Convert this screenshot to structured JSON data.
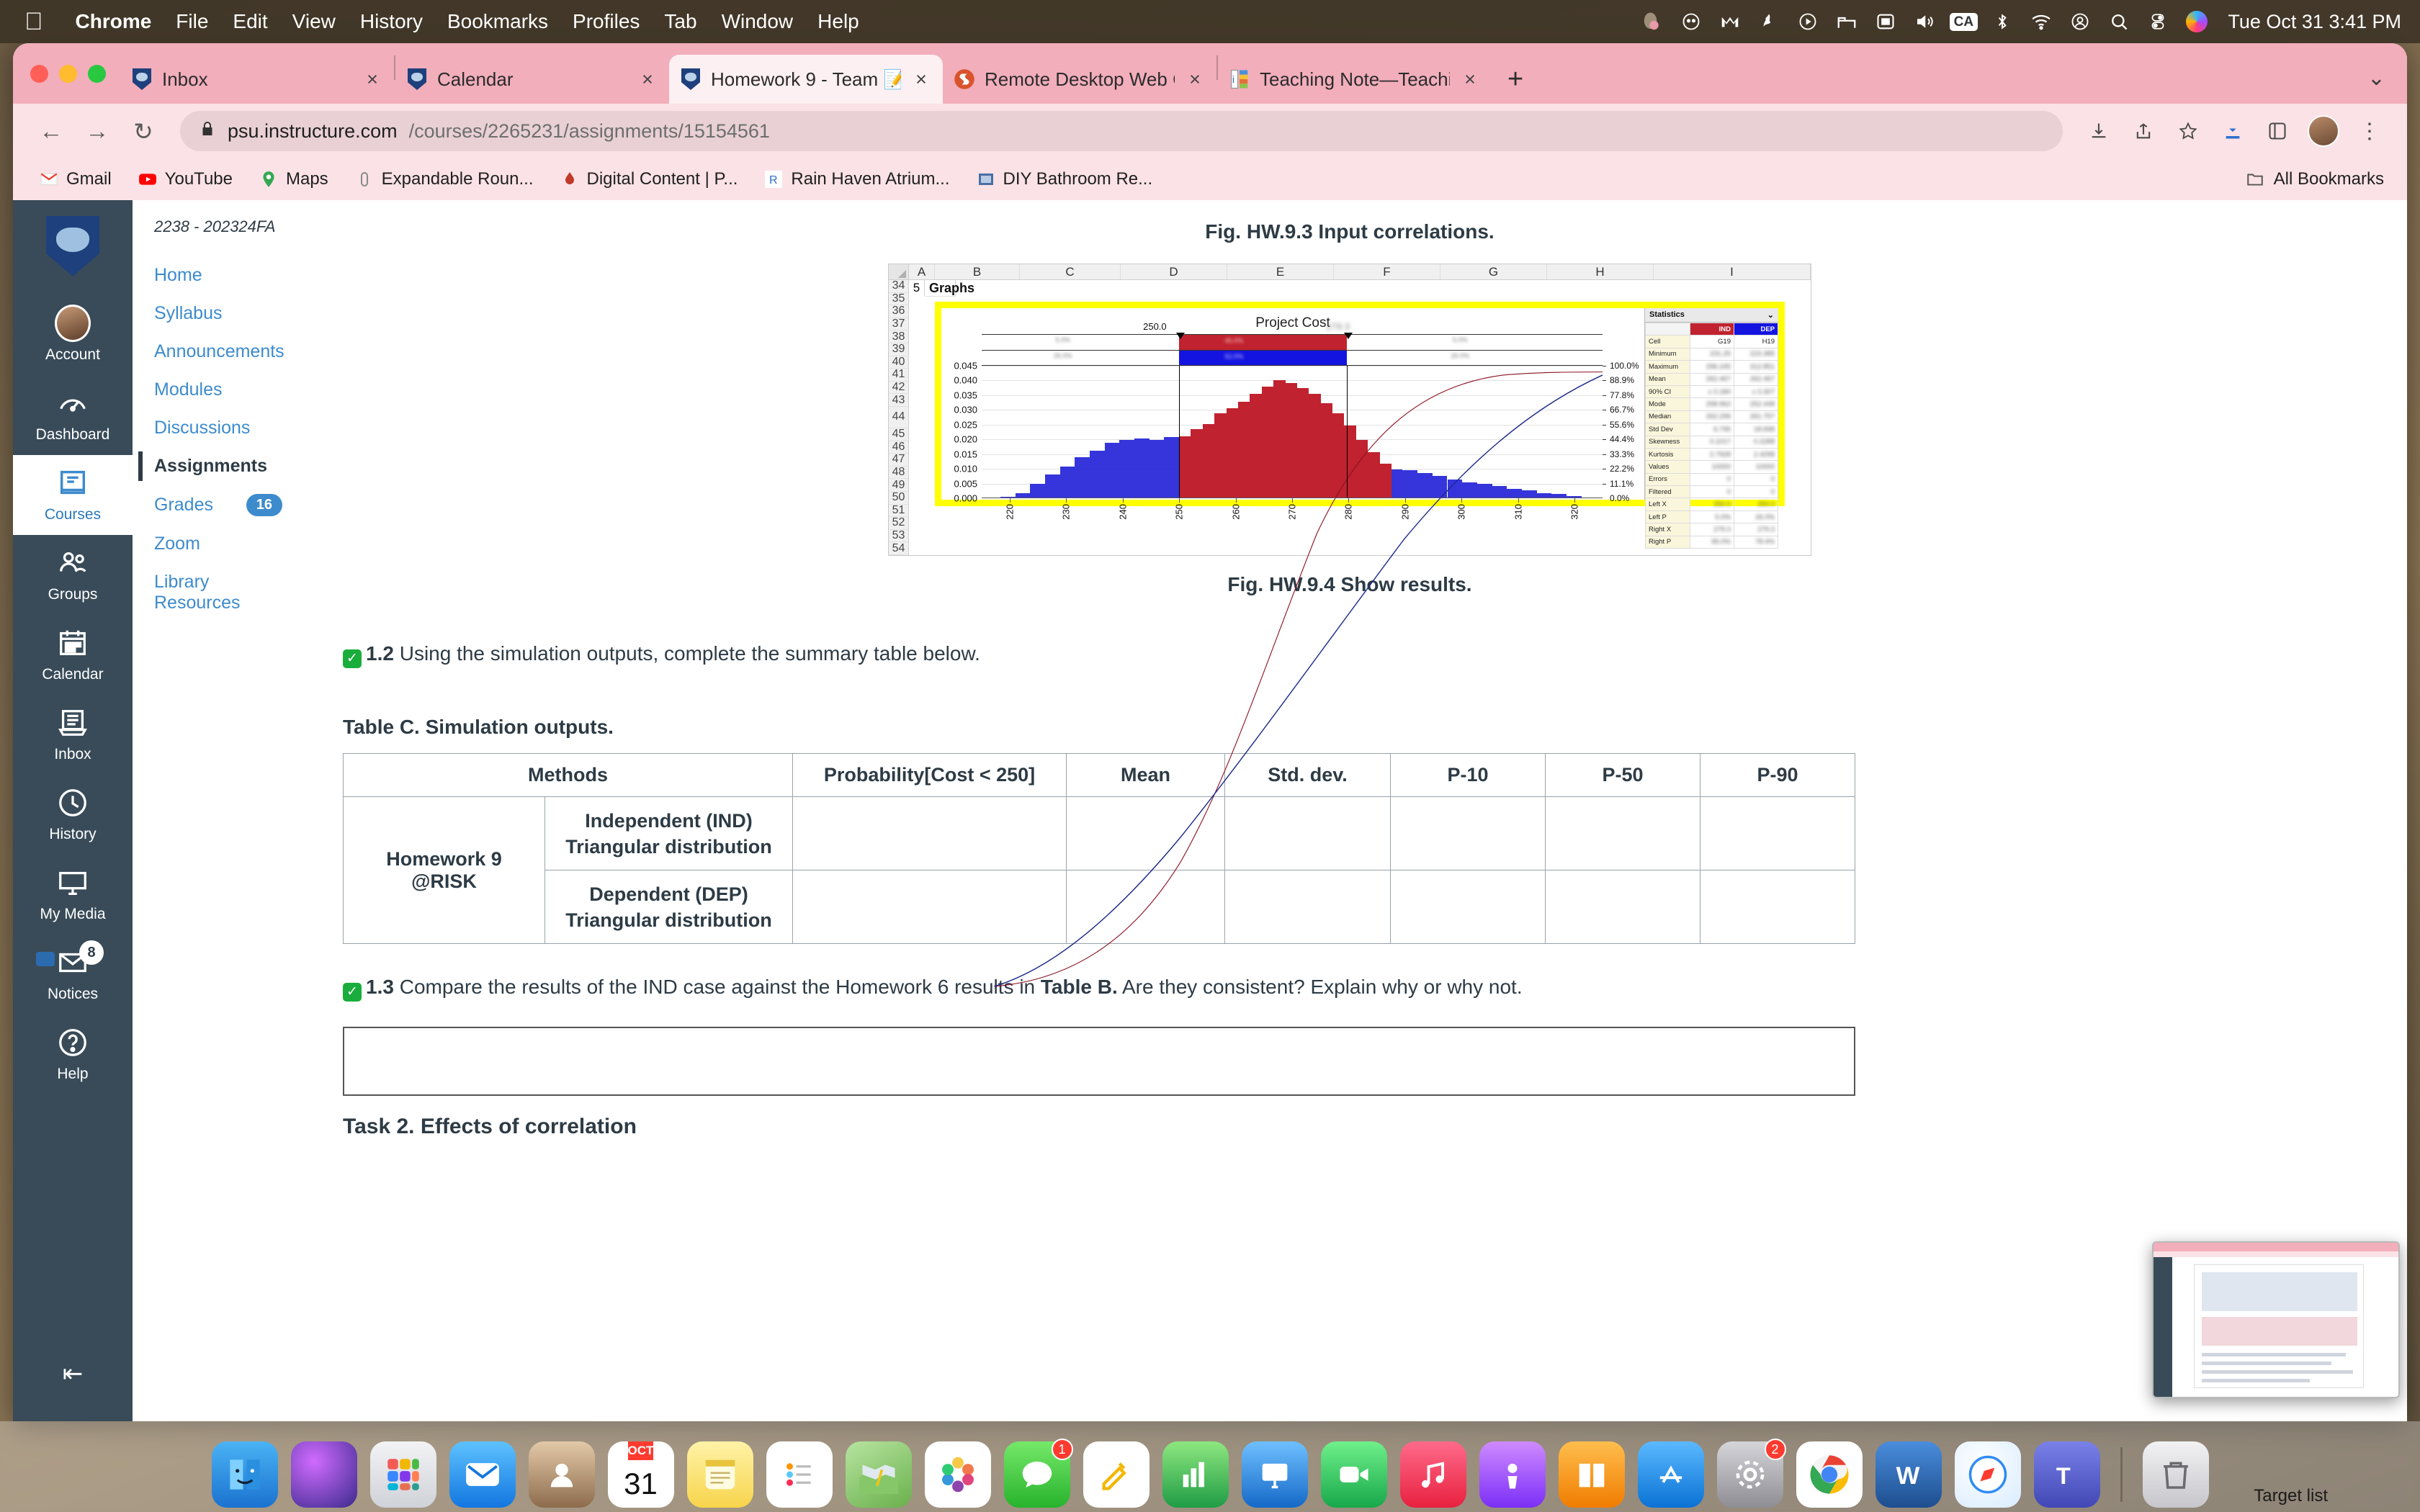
{
  "menubar": {
    "apple": "",
    "items": [
      {
        "label": "Chrome",
        "bold": true
      },
      {
        "label": "File",
        "bold": false
      },
      {
        "label": "Edit",
        "bold": false
      },
      {
        "label": "View",
        "bold": false
      },
      {
        "label": "History",
        "bold": false
      },
      {
        "label": "Bookmarks",
        "bold": false
      },
      {
        "label": "Profiles",
        "bold": false
      },
      {
        "label": "Tab",
        "bold": false
      },
      {
        "label": "Window",
        "bold": false
      },
      {
        "label": "Help",
        "bold": false
      }
    ],
    "status_icons": [
      "grammarly-icon",
      "ghost-icon",
      "mendeley-icon",
      "dropbox-icon",
      "play-circle-icon",
      "bed-icon",
      "screen-icon",
      "volume-icon",
      "ca-badge-icon",
      "bluetooth-icon",
      "wifi-icon",
      "user-circle-icon",
      "spotlight-search-icon",
      "control-center-icon",
      "siri-icon"
    ],
    "ca_badge": "CA",
    "clock": "Tue Oct 31  3:41 PM"
  },
  "browser": {
    "tabs": [
      {
        "title": "Inbox",
        "favicon": "psu-shield-icon",
        "active": false,
        "close": "×"
      },
      {
        "title": "Calendar",
        "favicon": "psu-shield-icon",
        "active": false,
        "close": "×"
      },
      {
        "title": "Homework 9 - Team 📝",
        "favicon": "psu-shield-icon",
        "active": true,
        "close": "×"
      },
      {
        "title": "Remote Desktop Web Client",
        "favicon": "remote-desktop-icon",
        "active": false,
        "close": "×"
      },
      {
        "title": "Teaching Note—Teaching Proje",
        "favicon": "teaching-note-icon",
        "active": false,
        "close": "×"
      }
    ],
    "new_tab": "+",
    "tab_list_caret": "⌄",
    "nav": {
      "back": "←",
      "forward": "→",
      "reload": "↻"
    },
    "omnibox": {
      "lock": "🔒",
      "url_bold": "psu.instructure.com",
      "url_dim": "/courses/2265231/assignments/15154561"
    },
    "toolbar_icons": [
      "save-icon",
      "share-icon",
      "bookmark-star-icon",
      "download-icon",
      "extensions-icon",
      "profile-avatar-icon",
      "chrome-menu-icon"
    ],
    "bookmarks": [
      {
        "label": "Gmail",
        "icon": "gmail-icon"
      },
      {
        "label": "YouTube",
        "icon": "youtube-icon"
      },
      {
        "label": "Maps",
        "icon": "maps-icon"
      },
      {
        "label": "Expandable Roun...",
        "icon": "link-icon"
      },
      {
        "label": "Digital Content | P...",
        "icon": "drop-icon"
      },
      {
        "label": "Rain Haven Atrium...",
        "icon": "r-letter-icon"
      },
      {
        "label": "DIY Bathroom Re...",
        "icon": "image-icon"
      }
    ],
    "all_bookmarks": "All Bookmarks",
    "all_bookmarks_icon": "folder-icon"
  },
  "global_nav": {
    "logo": "penn-state-shield-logo",
    "items": [
      {
        "label": "Account",
        "icon": "avatar-icon",
        "active": false,
        "badge": ""
      },
      {
        "label": "Dashboard",
        "icon": "dashboard-icon",
        "active": false,
        "badge": ""
      },
      {
        "label": "Courses",
        "icon": "courses-book-icon",
        "active": true,
        "badge": ""
      },
      {
        "label": "Groups",
        "icon": "groups-people-icon",
        "active": false,
        "badge": ""
      },
      {
        "label": "Calendar",
        "icon": "calendar-icon",
        "active": false,
        "badge": ""
      },
      {
        "label": "Inbox",
        "icon": "inbox-tray-icon",
        "active": false,
        "badge": ""
      },
      {
        "label": "History",
        "icon": "clock-icon",
        "active": false,
        "badge": ""
      },
      {
        "label": "My Media",
        "icon": "monitor-icon",
        "active": false,
        "badge": ""
      },
      {
        "label": "Notices",
        "icon": "envelope-icon",
        "active": false,
        "badge": "8"
      },
      {
        "label": "Help",
        "icon": "question-circle-icon",
        "active": false,
        "badge": ""
      }
    ],
    "collapse": "⇤"
  },
  "course_nav": {
    "term": "2238 - 202324FA",
    "items": [
      {
        "label": "Home",
        "active": false,
        "badge": ""
      },
      {
        "label": "Syllabus",
        "active": false,
        "badge": ""
      },
      {
        "label": "Announcements",
        "active": false,
        "badge": ""
      },
      {
        "label": "Modules",
        "active": false,
        "badge": ""
      },
      {
        "label": "Discussions",
        "active": false,
        "badge": ""
      },
      {
        "label": "Assignments",
        "active": true,
        "badge": ""
      },
      {
        "label": "Grades",
        "active": false,
        "badge": "16"
      },
      {
        "label": "Zoom",
        "active": false,
        "badge": ""
      },
      {
        "label": "Library Resources",
        "active": false,
        "badge": ""
      }
    ]
  },
  "content": {
    "fig_caption_top": "Fig. HW.9.3 Input correlations.",
    "fig_caption_bottom": "Fig. HW.9.4 Show results.",
    "excel": {
      "columns": [
        "A",
        "B",
        "C",
        "D",
        "E",
        "F",
        "G",
        "H",
        "I"
      ],
      "rows": [
        "34",
        "35",
        "36",
        "37",
        "38",
        "39",
        "40",
        "41",
        "42",
        "43",
        "44",
        "45",
        "46",
        "47",
        "48",
        "49",
        "50",
        "51",
        "52",
        "53",
        "54"
      ],
      "cell_a34": "5",
      "cell_b34": "Graphs"
    },
    "q12": {
      "check": "✓",
      "number": "1.2",
      "text": " Using the simulation outputs, complete the summary table below."
    },
    "table_caption": "Table C. Simulation outputs.",
    "table": {
      "headers": [
        "Methods",
        "Probability[Cost < 250]",
        "Mean",
        "Std. dev.",
        "P-10",
        "P-50",
        "P-90"
      ],
      "row_group_label": "Homework 9\n@RISK",
      "row_group_label_l1": "Homework 9",
      "row_group_label_l2": "@RISK",
      "rows": [
        {
          "method_l1": "Independent (IND)",
          "method_l2": "Triangular distribution",
          "prob": "",
          "mean": "",
          "std": "",
          "p10": "",
          "p50": "",
          "p90": ""
        },
        {
          "method_l1": "Dependent (DEP)",
          "method_l2": "Triangular distribution",
          "prob": "",
          "mean": "",
          "std": "",
          "p10": "",
          "p50": "",
          "p90": ""
        }
      ]
    },
    "q13": {
      "check": "✓",
      "number": "1.3",
      "text_a": " Compare the results of the IND case against the Homework 6 results in ",
      "bold": "Table B.",
      "text_b": " Are they consistent? Explain why or why not."
    },
    "answer_placeholder": "",
    "task2": "Task 2. Effects of correlation"
  },
  "chart_data": {
    "type": "histogram",
    "title": "Project Cost",
    "xlabel": "",
    "ylabel": "",
    "xlim": [
      215,
      325
    ],
    "ylim": [
      0.0,
      0.045
    ],
    "y_ticks": [
      "0.000",
      "0.005",
      "0.010",
      "0.015",
      "0.020",
      "0.025",
      "0.030",
      "0.035",
      "0.040",
      "0.045"
    ],
    "y2_ticks": [
      "0.0%",
      "11.1%",
      "22.2%",
      "33.3%",
      "44.4%",
      "55.6%",
      "66.7%",
      "77.8%",
      "88.9%",
      "100.0%"
    ],
    "x_ticks": [
      "220",
      "230",
      "240",
      "250",
      "260",
      "270",
      "280",
      "290",
      "300",
      "310",
      "320"
    ],
    "delimiters": {
      "left_label": "250.0",
      "right_label": "279.3"
    },
    "bands": [
      {
        "name": "IND",
        "color": "#c0222f",
        "left_pct": "5.0%",
        "mid_pct": "45.0%",
        "right_pct": "5.0%"
      },
      {
        "name": "DEP",
        "color": "#1414e0",
        "left_pct": "26.0%",
        "mid_pct": "52.0%",
        "right_pct": "26.0%"
      }
    ],
    "series": [
      {
        "name": "IND",
        "color": "#c0222f",
        "x": [
          250,
          252,
          254,
          256,
          258,
          260,
          262,
          264,
          266,
          268,
          270,
          272,
          274,
          276,
          278
        ],
        "values": [
          0.021,
          0.023,
          0.027,
          0.033,
          0.036,
          0.038,
          0.04,
          0.039,
          0.037,
          0.034,
          0.031,
          0.027,
          0.022,
          0.017,
          0.015
        ]
      },
      {
        "name": "DEP",
        "color": "#2424d8",
        "x": [
          220,
          224,
          228,
          232,
          236,
          240,
          244,
          248,
          252,
          256,
          260,
          264,
          268,
          272,
          276,
          280,
          284,
          288,
          292,
          296,
          300,
          304,
          308,
          312,
          316
        ],
        "values": [
          0.0005,
          0.002,
          0.005,
          0.008,
          0.011,
          0.014,
          0.016,
          0.019,
          0.02,
          0.021,
          0.02,
          0.019,
          0.018,
          0.017,
          0.015,
          0.013,
          0.011,
          0.009,
          0.008,
          0.006,
          0.005,
          0.004,
          0.003,
          0.002,
          0.001
        ]
      }
    ],
    "cumulative_curves": [
      {
        "name": "IND cumulative",
        "color": "#8a1020"
      },
      {
        "name": "DEP cumulative",
        "color": "#1b2a8a"
      }
    ],
    "statistics": {
      "title": "Statistics",
      "collapse_icon": "⌄",
      "col_headers": [
        "",
        "IND",
        "DEP"
      ],
      "rows": [
        {
          "label": "Cell",
          "ind": "G19",
          "dep": "H19",
          "blurred": false
        },
        {
          "label": "Minimum",
          "ind": "231.25",
          "dep": "223.385",
          "blurred": true
        },
        {
          "label": "Maximum",
          "ind": "296.245",
          "dep": "312.851",
          "blurred": true
        },
        {
          "label": "Mean",
          "ind": "262.467",
          "dep": "262.467",
          "blurred": true
        },
        {
          "label": "90% CI",
          "ind": "± 0.180",
          "dep": "± 0.307",
          "blurred": true
        },
        {
          "label": "Mode",
          "ind": "258.962",
          "dep": "252.448",
          "blurred": true
        },
        {
          "label": "Median",
          "ind": "262.296",
          "dep": "261.757",
          "blurred": true
        },
        {
          "label": "Std Dev",
          "ind": "6.795",
          "dep": "18.698",
          "blurred": true
        },
        {
          "label": "Skewness",
          "ind": "0.1017",
          "dep": "0.2288",
          "blurred": true
        },
        {
          "label": "Kurtosis",
          "ind": "2.7928",
          "dep": "2.4298",
          "blurred": true
        },
        {
          "label": "Values",
          "ind": "10000",
          "dep": "10000",
          "blurred": true
        },
        {
          "label": "Errors",
          "ind": "0",
          "dep": "0",
          "blurred": true
        },
        {
          "label": "Filtered",
          "ind": "0",
          "dep": "0",
          "blurred": true
        },
        {
          "label": "Left X",
          "ind": "250.0",
          "dep": "250.0",
          "blurred": true
        },
        {
          "label": "Left P",
          "ind": "5.0%",
          "dep": "26.0%",
          "blurred": true
        },
        {
          "label": "Right X",
          "ind": "279.3",
          "dep": "279.3",
          "blurred": true
        },
        {
          "label": "Right P",
          "ind": "95.0%",
          "dep": "78.4%",
          "blurred": true
        }
      ]
    }
  },
  "dock": {
    "apps": [
      {
        "name": "finder-icon",
        "glyph": "🕵",
        "color": "#2196f3",
        "badge": ""
      },
      {
        "name": "siri-icon",
        "glyph": "",
        "color": "#6a3fb5",
        "badge": ""
      },
      {
        "name": "launchpad-icon",
        "glyph": "⌸",
        "color": "#d9d9d9",
        "badge": ""
      },
      {
        "name": "mail-icon",
        "glyph": "✉",
        "color": "#2f8bf4",
        "badge": ""
      },
      {
        "name": "contacts-icon",
        "glyph": "👤",
        "color": "#b48a5e",
        "badge": ""
      },
      {
        "name": "calendar-icon",
        "glyph": "",
        "color": "#ffffff",
        "badge": "",
        "month": "OCT",
        "day": "31"
      },
      {
        "name": "notes-icon",
        "glyph": "",
        "color": "#fdd835",
        "badge": ""
      },
      {
        "name": "reminders-icon",
        "glyph": "☰",
        "color": "#ffffff",
        "badge": ""
      },
      {
        "name": "maps-icon",
        "glyph": "",
        "color": "#8bc34a",
        "badge": ""
      },
      {
        "name": "photos-icon",
        "glyph": "✿",
        "color": "#ffffff",
        "badge": ""
      },
      {
        "name": "messages-icon",
        "glyph": "💬",
        "color": "#4cd964",
        "badge": "1"
      },
      {
        "name": "freeform-icon",
        "glyph": "✎",
        "color": "#ffffff",
        "badge": ""
      },
      {
        "name": "numbers-icon",
        "glyph": "📊",
        "color": "#2aa84a",
        "badge": ""
      },
      {
        "name": "keynote-icon",
        "glyph": "▣",
        "color": "#2f8bf4",
        "badge": ""
      },
      {
        "name": "facetime-icon",
        "glyph": "📹",
        "color": "#34c759",
        "badge": ""
      },
      {
        "name": "music-icon",
        "glyph": "♫",
        "color": "#fa3c5a",
        "badge": ""
      },
      {
        "name": "podcasts-icon",
        "glyph": "◉",
        "color": "#9b51e0",
        "badge": ""
      },
      {
        "name": "books-icon",
        "glyph": "📖",
        "color": "#ff9500",
        "badge": ""
      },
      {
        "name": "appstore-icon",
        "glyph": "A",
        "color": "#2f8bf4",
        "badge": ""
      },
      {
        "name": "settings-icon",
        "glyph": "⚙",
        "color": "#8e8e93",
        "badge": "2"
      },
      {
        "name": "chrome-icon",
        "glyph": "",
        "color": "#ffffff",
        "badge": ""
      },
      {
        "name": "word-icon",
        "glyph": "W",
        "color": "#2b579a",
        "badge": ""
      },
      {
        "name": "safari-icon",
        "glyph": "🧭",
        "color": "#ffffff",
        "badge": ""
      },
      {
        "name": "teams-icon",
        "glyph": "T",
        "color": "#5059c9",
        "badge": ""
      },
      {
        "name": "trash-icon",
        "glyph": "🗑",
        "color": "#d8d8d8",
        "badge": ""
      }
    ]
  },
  "pip": {
    "label": "Target list"
  }
}
